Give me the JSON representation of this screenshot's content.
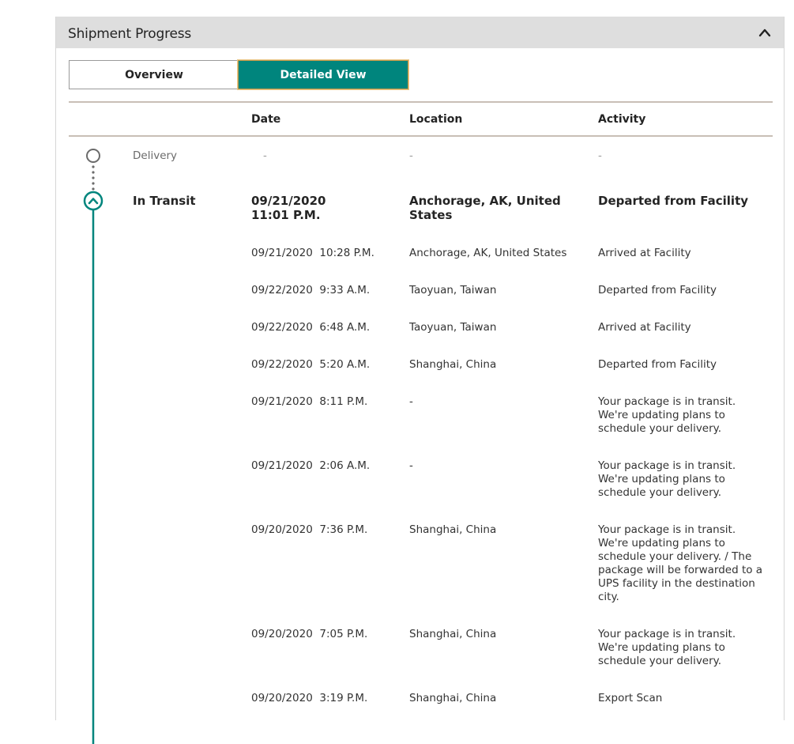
{
  "panel": {
    "title": "Shipment Progress"
  },
  "toggle": {
    "overview_label": "Overview",
    "detailed_label": "Detailed View"
  },
  "columns": {
    "date": "Date",
    "location": "Location",
    "activity": "Activity"
  },
  "milestones": {
    "delivery": {
      "label": "Delivery",
      "date": "-",
      "location": "-",
      "activity": "-"
    },
    "in_transit": {
      "label": "In Transit",
      "date_line1": "09/21/2020",
      "date_line2": "11:01 P.M.",
      "location_line1": "Anchorage, AK, United",
      "location_line2": "States",
      "activity": "Departed from Facility"
    }
  },
  "events": [
    {
      "date": "09/21/2020  10:28 P.M.",
      "location": "Anchorage, AK, United States",
      "activity": [
        "Arrived at Facility"
      ]
    },
    {
      "date": "09/22/2020  9:33 A.M.",
      "location": "Taoyuan, Taiwan",
      "activity": [
        "Departed from Facility"
      ]
    },
    {
      "date": "09/22/2020  6:48 A.M.",
      "location": "Taoyuan, Taiwan",
      "activity": [
        "Arrived at Facility"
      ]
    },
    {
      "date": "09/22/2020  5:20 A.M.",
      "location": "Shanghai, China",
      "activity": [
        "Departed from Facility"
      ]
    },
    {
      "date": "09/21/2020  8:11 P.M.",
      "location": "-",
      "activity": [
        "Your package is in transit.",
        "We're updating plans to",
        "schedule your delivery."
      ]
    },
    {
      "date": "09/21/2020  2:06 A.M.",
      "location": "-",
      "activity": [
        "Your package is in transit.",
        "We're updating plans to",
        "schedule your delivery."
      ]
    },
    {
      "date": "09/20/2020  7:36 P.M.",
      "location": "Shanghai, China",
      "activity": [
        "Your package is in transit.",
        "We're updating plans to",
        "schedule your delivery. / The",
        "package will be forwarded to a",
        "UPS facility in the destination",
        "city."
      ]
    },
    {
      "date": "09/20/2020  7:05 P.M.",
      "location": "Shanghai, China",
      "activity": [
        "Your package is in transit.",
        "We're updating plans to",
        "schedule your delivery."
      ]
    },
    {
      "date": "09/20/2020  3:19 P.M.",
      "location": "Shanghai, China",
      "activity": [
        "Export Scan"
      ]
    }
  ],
  "icons": {
    "collapse": "chevron-up-icon",
    "delivery_node": "empty-circle-icon",
    "transit_node": "chevron-up-circle-icon"
  },
  "colors": {
    "accent": "#00857d",
    "header_bg": "#dedede",
    "rule": "#c9bfb6"
  }
}
